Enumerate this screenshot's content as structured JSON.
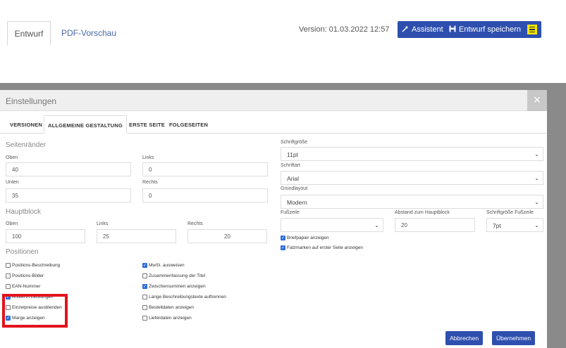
{
  "topbar": {
    "tabs": [
      {
        "label": "Entwurf"
      },
      {
        "label": "PDF-Vorschau"
      }
    ],
    "version": "Version: 01.03.2022 12:57",
    "assistant_label": "Assistent",
    "save_label": "Entwurf speichern"
  },
  "modal": {
    "title": "Einstellungen",
    "close": "×",
    "tabs": [
      "VERSIONEN",
      "ALLGEMEINE GESTALTUNG",
      "ERSTE SEITE",
      "FOLGESEITEN"
    ],
    "active_tab": "ALLGEMEINE GESTALTUNG",
    "seitenraender": {
      "title": "Seitenränder",
      "oben_label": "Oben",
      "oben": "40",
      "links_label": "Links",
      "links": "0",
      "unten_label": "Unten",
      "unten": "35",
      "rechts_label": "Rechts",
      "rechts": "0"
    },
    "hauptblock": {
      "title": "Hauptblock",
      "oben_label": "Oben",
      "oben": "100",
      "links_label": "Links",
      "links": "25",
      "rechts_label": "Rechts",
      "rechts": "20"
    },
    "positionen": {
      "title": "Positionen",
      "left": [
        {
          "label": "Positions-Beschreibung",
          "checked": false
        },
        {
          "label": "Positions-Bilder",
          "checked": false
        },
        {
          "label": "EAN-Nummer",
          "checked": false
        },
        {
          "label": "Artikel in Leistungen",
          "checked": true
        },
        {
          "label": "Einzelpreise ausblenden",
          "checked": false
        },
        {
          "label": "Marge anzeigen",
          "checked": true
        }
      ],
      "right": [
        {
          "label": "MwSt. ausweisen",
          "checked": true
        },
        {
          "label": "Zusammenfassung der Titel",
          "checked": false
        },
        {
          "label": "Zwischensummen anzeigen",
          "checked": true
        },
        {
          "label": "Lange Beschreibungstexte auftrennen",
          "checked": false
        },
        {
          "label": "Bestelldaten anzeigen",
          "checked": false
        },
        {
          "label": "Lieferdaten anzeigen",
          "checked": false
        }
      ]
    },
    "right": {
      "schriftgroesse_label": "Schriftgröße",
      "schriftgroesse": "11pt",
      "schriftart_label": "Schriftart",
      "schriftart": "Arial",
      "grundlayout_label": "Grundlayout",
      "grundlayout": "Modern",
      "fusszeile_label": "Fußzeile",
      "fusszeile": "",
      "abstand_label": "Abstand zum Hauptblock",
      "abstand": "20",
      "fs_groesse_label": "Schriftgröße Fußzeile",
      "fs_groesse": "7pt",
      "briefpapier": {
        "label": "Briefpapier anzeigen",
        "checked": true
      },
      "falzmarken": {
        "label": "Falzmarken auf erster Seite anzeigen",
        "checked": true
      }
    },
    "buttons": {
      "cancel": "Abbrechen",
      "apply": "Übernehmen"
    }
  },
  "colors": {
    "accent": "#2e4fae",
    "highlight": "#e3131d",
    "menu": "#f3e600"
  }
}
